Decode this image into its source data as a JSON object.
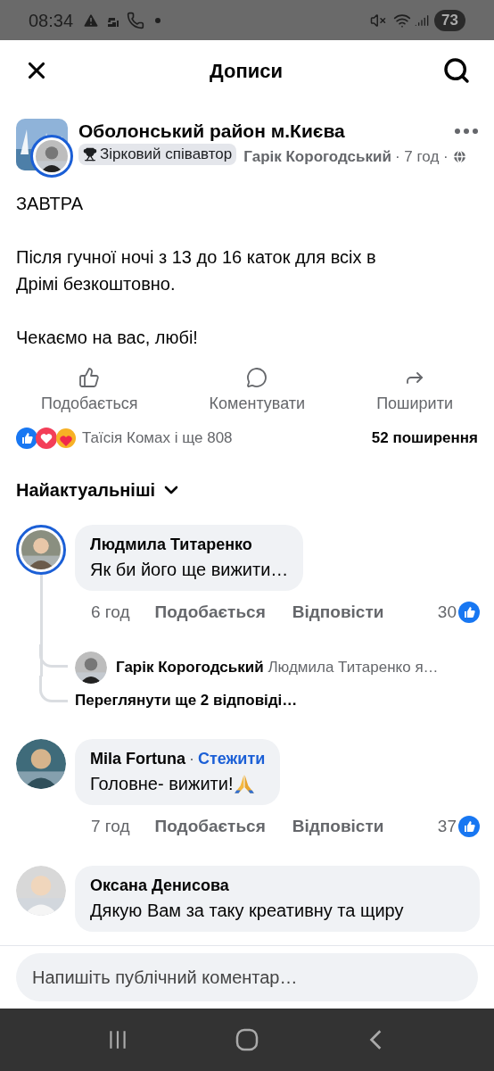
{
  "status_bar": {
    "time": "08:34",
    "battery": "73"
  },
  "header": {
    "title": "Дописи"
  },
  "post": {
    "group": "Оболонський район м.Києва",
    "badge": "Зірковий співавтор",
    "author": "Гарік Корогодський",
    "time": "· 7 год ·",
    "paragraphs": [
      "ЗАВТРА",
      "Після гучної ночі з 13 до 16 каток для всіх в Дрімі безкоштовно.",
      "Чекаємо на вас, любі!"
    ],
    "actions": [
      {
        "label": "Подобається",
        "kind": "like"
      },
      {
        "label": "Коментувати",
        "kind": "comment"
      },
      {
        "label": "Поширити",
        "kind": "share"
      }
    ],
    "reactions": "Таїсія Комах і ще 808",
    "shares": "52 поширення"
  },
  "sort": {
    "label": "Найактуальніші"
  },
  "comments": [
    {
      "name": "Людмила Титаренко",
      "ring": true,
      "text": "Як би його ще вижити…",
      "time": "6 год",
      "like": "Подобається",
      "reply": "Відповісти",
      "count": "30",
      "replies": [
        {
          "name": "Гарік Корогодський",
          "text": "Людмила Титаренко я…"
        }
      ],
      "more": "Переглянути ще 2 відповіді…"
    },
    {
      "name": "Mila Fortuna",
      "ring": false,
      "separator": "·",
      "follow": "Стежити",
      "text": "Головне- вижити!",
      "prayer": true,
      "time": "7 год",
      "like": "Подобається",
      "reply": "Відповісти",
      "count": "37"
    },
    {
      "name": "Оксана Денисова",
      "ring": false,
      "text": "Дякую Вам за таку  креативну та щиру"
    }
  ],
  "composer": {
    "placeholder": "Напишіть публічний коментар…"
  }
}
